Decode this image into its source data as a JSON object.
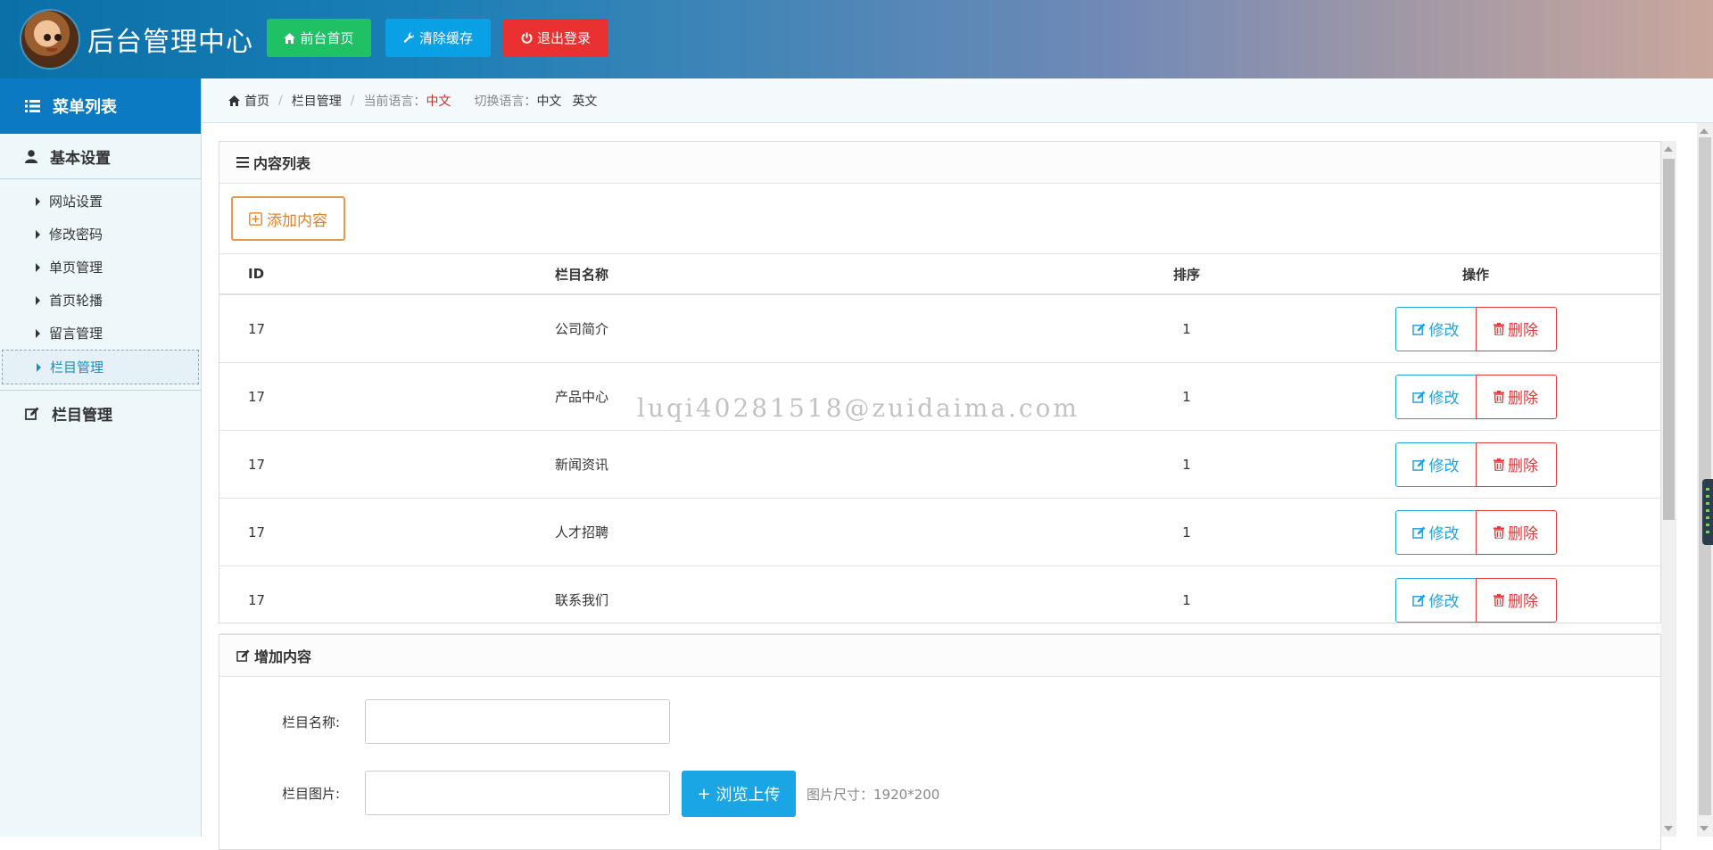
{
  "header": {
    "title": "后台管理中心",
    "buttons": {
      "home": "前台首页",
      "cache": "清除缓存",
      "logout": "退出登录"
    }
  },
  "sidebar": {
    "menu_title": "菜单列表",
    "group_basic": "基本设置",
    "items": [
      {
        "label": "网站设置"
      },
      {
        "label": "修改密码"
      },
      {
        "label": "单页管理"
      },
      {
        "label": "首页轮播"
      },
      {
        "label": "留言管理"
      },
      {
        "label": "栏目管理"
      }
    ],
    "group_column": "栏目管理"
  },
  "breadcrumb": {
    "home": "首页",
    "current": "栏目管理",
    "lang_label": "当前语言：",
    "lang_value": "中文",
    "switch_label": "切换语言：",
    "switch_zh": "中文",
    "switch_en": "英文"
  },
  "content_list": {
    "title": "内容列表",
    "add_button": "添加内容",
    "columns": [
      "ID",
      "栏目名称",
      "排序",
      "操作"
    ],
    "rows": [
      {
        "id": "17",
        "name": "公司简介",
        "sort": "1"
      },
      {
        "id": "17",
        "name": "产品中心",
        "sort": "1"
      },
      {
        "id": "17",
        "name": "新闻资讯",
        "sort": "1"
      },
      {
        "id": "17",
        "name": "人才招聘",
        "sort": "1"
      },
      {
        "id": "17",
        "name": "联系我们",
        "sort": "1"
      }
    ],
    "edit_label": "修改",
    "delete_label": "删除"
  },
  "add_form": {
    "title": "增加内容",
    "name_label": "栏目名称:",
    "name_value": "",
    "image_label": "栏目图片:",
    "image_value": "",
    "upload_button": "浏览上传",
    "image_hint": "图片尺寸：1920*200"
  },
  "watermark": "luqi40281518@zuidaima.com",
  "colors": {
    "sidebar_header": "#0c7ac2",
    "home_button": "#20c065",
    "cache_button": "#0aa0e5",
    "logout_button": "#e93131",
    "add_button": "#e4822a",
    "edit_button": "#23a3de",
    "delete_button": "#de3c3c",
    "upload_button": "#1aa6e4"
  },
  "icons": {
    "home": "home-icon",
    "cache": "wrench-icon",
    "logout": "power-icon",
    "menu": "list-icon",
    "user": "user-icon",
    "edit": "edit-icon",
    "delete": "trash-icon",
    "add": "plus-square-icon"
  }
}
